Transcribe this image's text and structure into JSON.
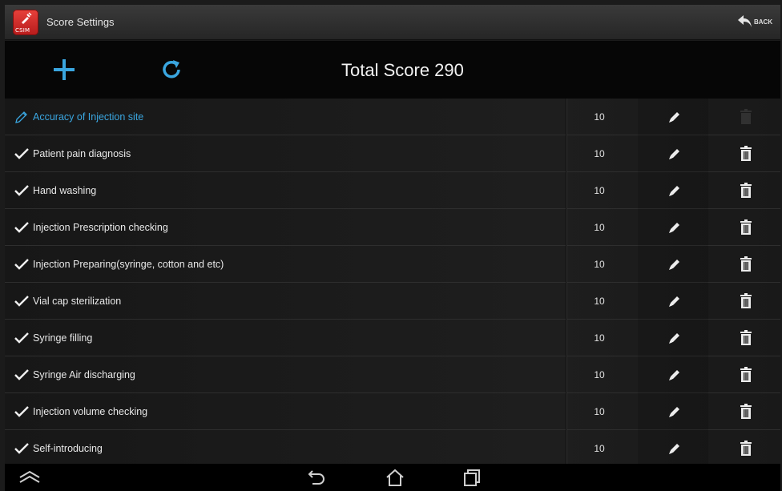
{
  "app": {
    "title": "Score Settings",
    "icon_label": "CSIM",
    "back_label": "BACK"
  },
  "toolbar": {
    "add_icon": "plus-icon",
    "refresh_icon": "refresh-icon",
    "total_label": "Total Score 290"
  },
  "colors": {
    "accent_blue": "#3aa6e0",
    "brand_red": "#d32f2f",
    "background": "#1b1b1b"
  },
  "items": [
    {
      "label": "Accuracy of Injection site",
      "score": "10",
      "state": "editing"
    },
    {
      "label": "Patient pain diagnosis",
      "score": "10",
      "state": "checked"
    },
    {
      "label": "Hand washing",
      "score": "10",
      "state": "checked"
    },
    {
      "label": "Injection Prescription checking",
      "score": "10",
      "state": "checked"
    },
    {
      "label": "Injection Preparing(syringe, cotton and etc)",
      "score": "10",
      "state": "checked"
    },
    {
      "label": "Vial cap sterilization",
      "score": "10",
      "state": "checked"
    },
    {
      "label": "Syringe filling",
      "score": "10",
      "state": "checked"
    },
    {
      "label": "Syringe Air discharging",
      "score": "10",
      "state": "checked"
    },
    {
      "label": "Injection volume checking",
      "score": "10",
      "state": "checked"
    },
    {
      "label": "Self-introducing",
      "score": "10",
      "state": "checked"
    }
  ],
  "navbar": {
    "buttons": [
      "menu-chevron-icon",
      "back-arrow-icon",
      "home-icon",
      "recent-apps-icon"
    ]
  }
}
